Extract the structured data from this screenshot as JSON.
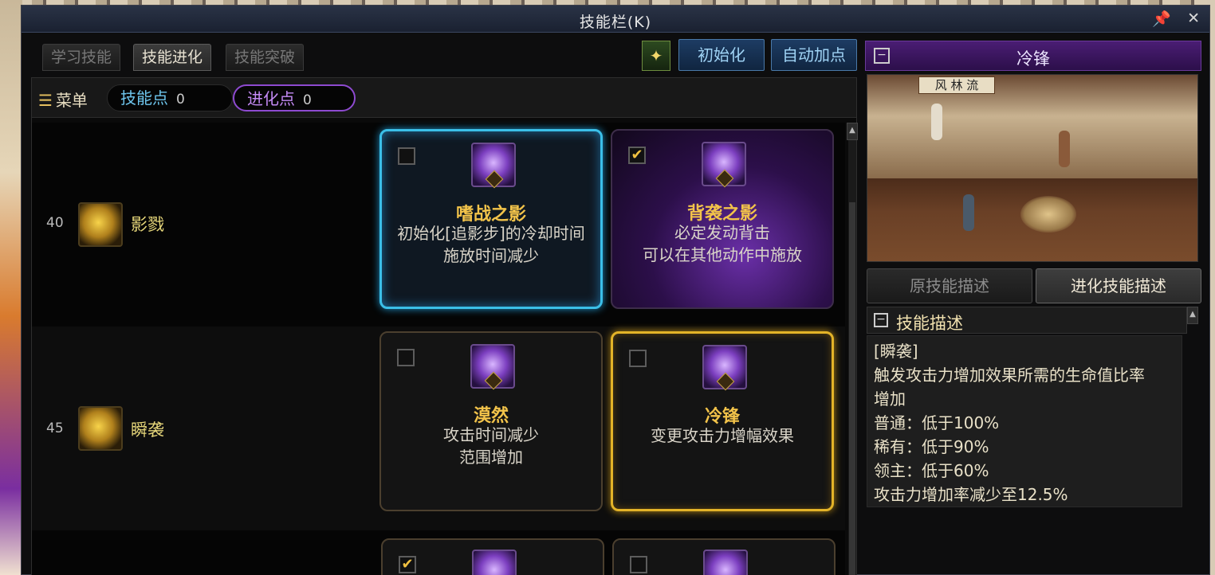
{
  "window": {
    "title": "技能栏(K)"
  },
  "tabs": [
    {
      "label": "学习技能",
      "active": false
    },
    {
      "label": "技能进化",
      "active": true
    },
    {
      "label": "技能突破",
      "active": false
    }
  ],
  "toolbar": {
    "evo_icon_glyph": "✦",
    "reset_label": "初始化",
    "auto_label": "自动加点"
  },
  "menu": {
    "label": "菜单",
    "skill_points_label": "技能点",
    "skill_points": "0",
    "evo_points_label": "进化点",
    "evo_points": "0"
  },
  "rows": [
    {
      "level": "40",
      "skill_name": "影戮",
      "options": [
        {
          "title": "嗜战之影",
          "desc1": "初始化[追影步]的冷却时间",
          "desc2": "施放时间减少",
          "checked": false,
          "checkmark": ""
        },
        {
          "title": "背袭之影",
          "desc1": "必定发动背击",
          "desc2": "可以在其他动作中施放",
          "checked": true,
          "checkmark": "✔"
        }
      ]
    },
    {
      "level": "45",
      "skill_name": "瞬袭",
      "options": [
        {
          "title": "漠然",
          "desc1": "攻击时间减少",
          "desc2": "范围增加",
          "checked": false,
          "checkmark": ""
        },
        {
          "title": "冷锋",
          "desc1": "变更攻击力增幅效果",
          "desc2": "",
          "checked": false,
          "checkmark": ""
        }
      ]
    },
    {
      "options": [
        {
          "checked": true,
          "checkmark": "✔"
        },
        {
          "checked": false,
          "checkmark": ""
        }
      ]
    }
  ],
  "detail": {
    "name": "冷锋",
    "preview_sign": "风 林 流",
    "tab_original": "原技能描述",
    "tab_evolved": "进化技能描述",
    "section_label": "技能描述",
    "lines": [
      "[瞬袭]",
      "触发攻击力增加效果所需的生命值比率",
      "增加",
      "普通：低于100%",
      "稀有：低于90%",
      "领主：低于60%",
      "攻击力增加率减少至12.5%"
    ]
  },
  "colors": {
    "accent_blue": "#3bbfe8",
    "accent_gold": "#e3b328",
    "accent_purple": "#8e4ad0",
    "title_gold": "#f2c34a"
  }
}
